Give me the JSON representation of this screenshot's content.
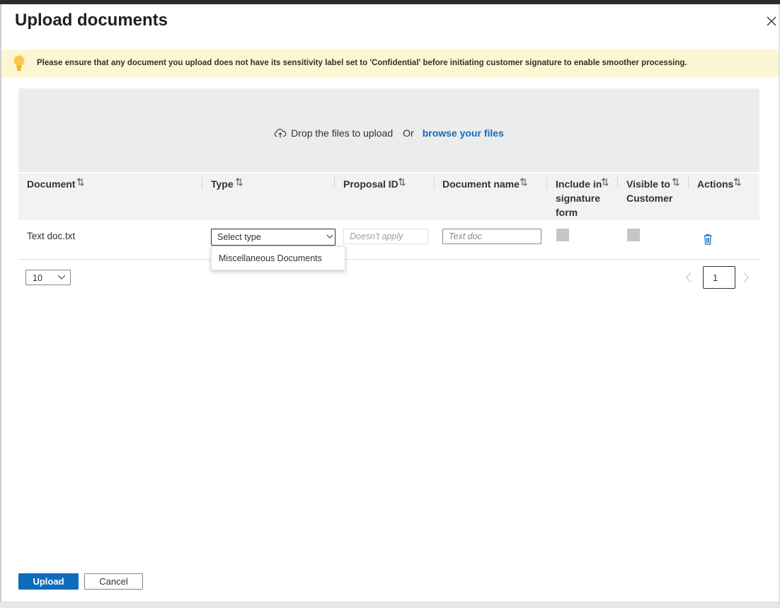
{
  "dialog": {
    "title": "Upload documents"
  },
  "banner": {
    "message": "Please ensure that any document you upload does not have its sensitivity label set to 'Confidential' before initiating customer signature to enable smoother processing."
  },
  "dropzone": {
    "text": "Drop the files to upload",
    "or": "Or",
    "browse_link": "browse your files"
  },
  "table": {
    "columns": [
      {
        "label": "Document"
      },
      {
        "label": "Type"
      },
      {
        "label": "Proposal ID"
      },
      {
        "label": "Document name"
      },
      {
        "label": "Include in signature form"
      },
      {
        "label": "Visible to Customer"
      },
      {
        "label": "Actions"
      }
    ],
    "rows": [
      {
        "document": "Text doc.txt",
        "type_placeholder": "Select type",
        "proposal_placeholder": "Doesn't apply",
        "docname_placeholder": "Text doc"
      }
    ]
  },
  "type_menu": {
    "options": [
      "Miscellaneous Documents"
    ]
  },
  "pagination": {
    "page_size": "10",
    "current_page": "1"
  },
  "footer": {
    "upload_label": "Upload",
    "cancel_label": "Cancel"
  },
  "colors": {
    "accent": "#0f6cbd",
    "banner_bg": "#fdf6d3",
    "header_bg": "#f3f2f1"
  }
}
